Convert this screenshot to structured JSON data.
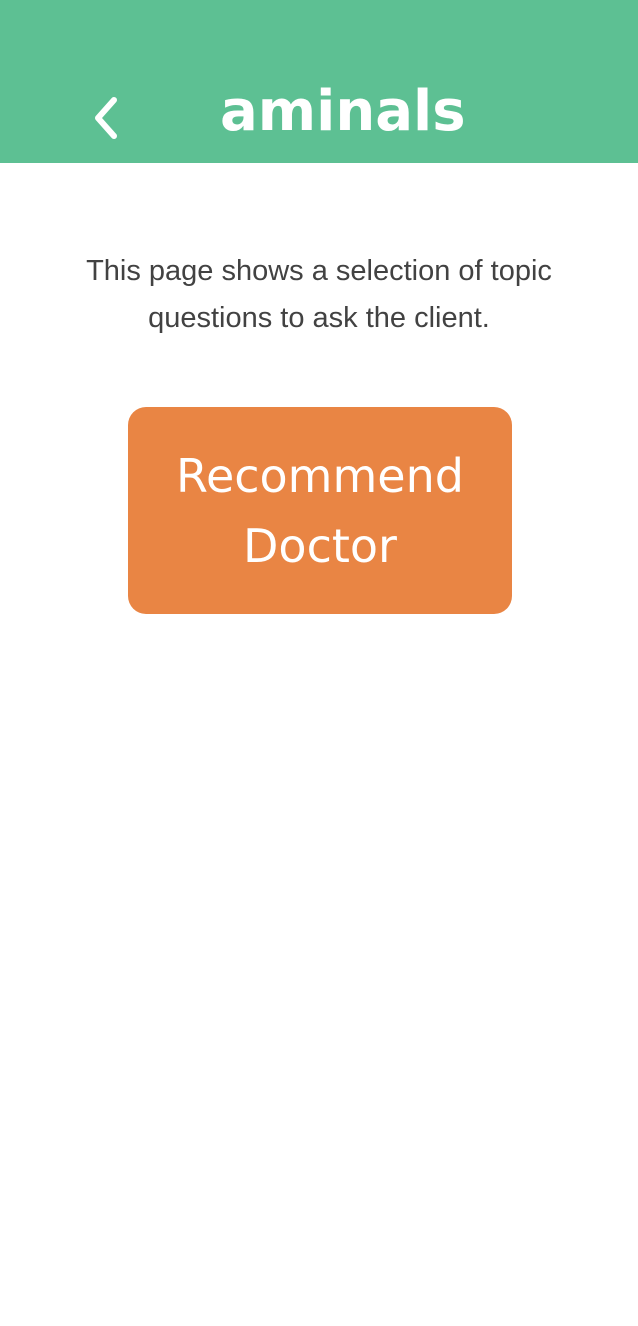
{
  "header": {
    "title": "aminals",
    "back_icon": "chevron-left-icon",
    "background_color": "#5dc093"
  },
  "main": {
    "description": "This page shows a selection of topic questions to ask the client.",
    "recommend_button_label": "Recommend Doctor",
    "recommend_button_color": "#e98544"
  }
}
